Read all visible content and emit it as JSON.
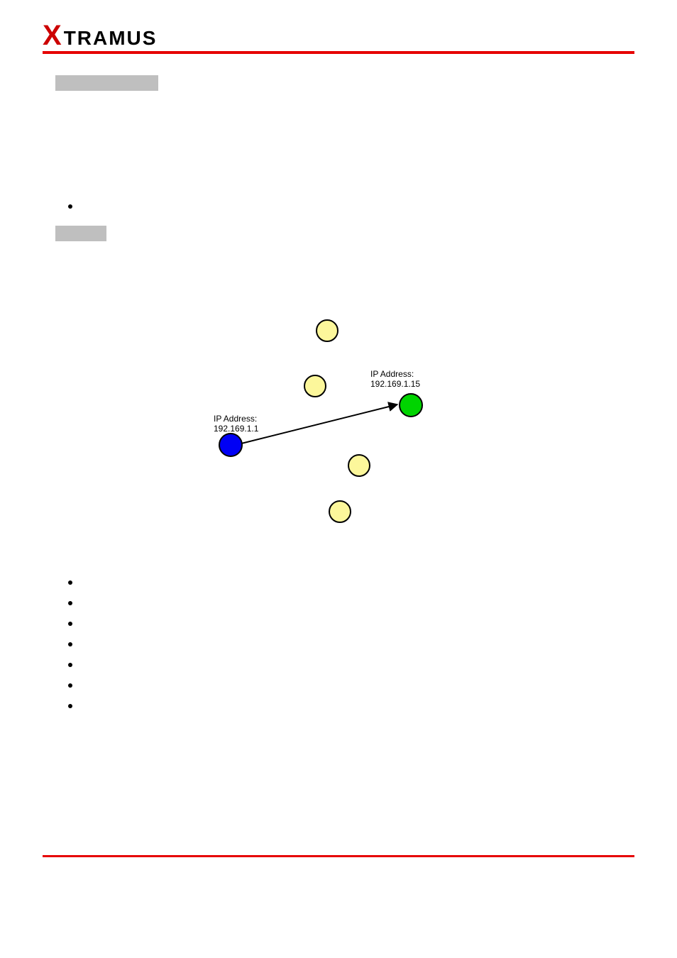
{
  "logo": {
    "x": "X",
    "rest": "TRAMUS"
  },
  "diagram": {
    "label_left": {
      "line1": "IP Address:",
      "line2": "192.169.1.1"
    },
    "label_right": {
      "line1": "IP Address:",
      "line2": "192.169.1.15"
    }
  },
  "colors": {
    "red": "#e60000",
    "grey": "#bfbfbf",
    "yellow": "#fcf79b",
    "blue": "#0000f5",
    "green": "#00d400"
  }
}
